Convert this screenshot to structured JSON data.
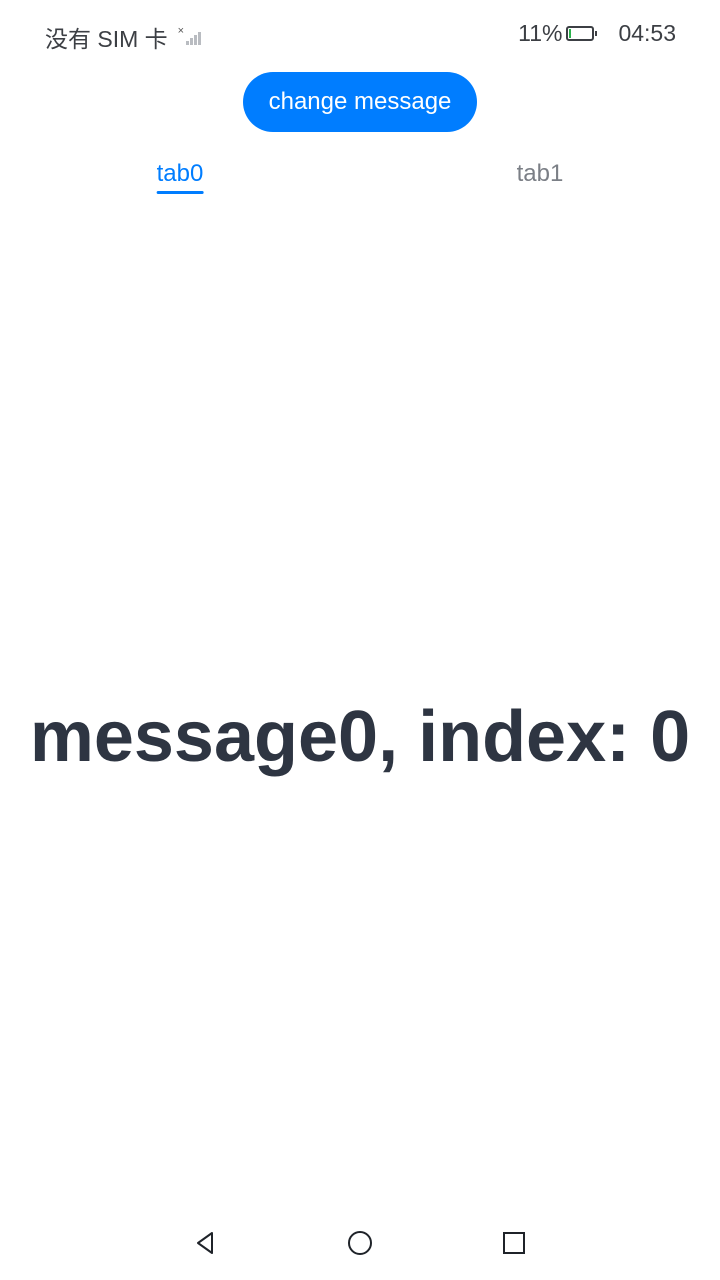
{
  "status_bar": {
    "carrier": "没有 SIM 卡",
    "battery_percent": "11%",
    "battery_level": 0.11,
    "time": "04:53",
    "battery_color": "#2bb24c"
  },
  "toolbar": {
    "change_label": "change message"
  },
  "tabs": [
    {
      "label": "tab0",
      "active": true
    },
    {
      "label": "tab1",
      "active": false
    }
  ],
  "content": {
    "message": "message0, index: 0"
  },
  "nav_bar": {
    "icons": [
      "back-icon",
      "home-icon",
      "recent-apps-icon"
    ]
  },
  "colors": {
    "accent": "#007dff",
    "text_primary": "#2e3542",
    "text_secondary": "#7b7f86"
  }
}
